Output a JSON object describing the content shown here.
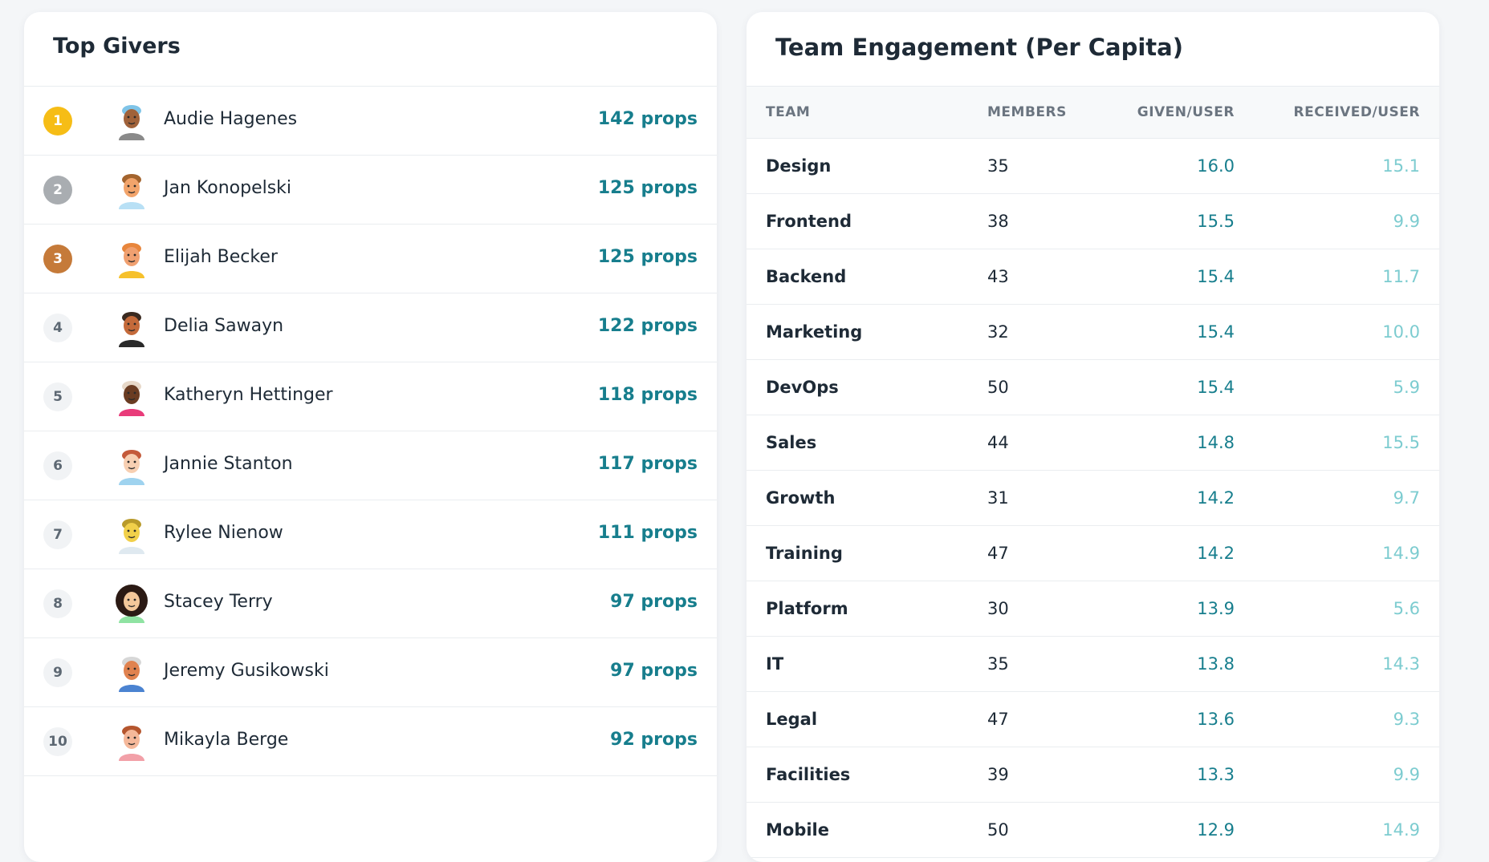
{
  "givers": {
    "title": "Top Givers",
    "items": [
      {
        "rank": "1",
        "name": "Audie Hagenes",
        "props": "142 props"
      },
      {
        "rank": "2",
        "name": "Jan Konopelski",
        "props": "125 props"
      },
      {
        "rank": "3",
        "name": "Elijah Becker",
        "props": "125 props"
      },
      {
        "rank": "4",
        "name": "Delia Sawayn",
        "props": "122 props"
      },
      {
        "rank": "5",
        "name": "Katheryn Hettinger",
        "props": "118 props"
      },
      {
        "rank": "6",
        "name": "Jannie Stanton",
        "props": "117 props"
      },
      {
        "rank": "7",
        "name": "Rylee Nienow",
        "props": "111 props"
      },
      {
        "rank": "8",
        "name": "Stacey Terry",
        "props": "97 props"
      },
      {
        "rank": "9",
        "name": "Jeremy Gusikowski",
        "props": "97 props"
      },
      {
        "rank": "10",
        "name": "Mikayla Berge",
        "props": "92 props"
      }
    ]
  },
  "teams": {
    "title": "Team Engagement (Per Capita)",
    "headers": {
      "team": "TEAM",
      "members": "MEMBERS",
      "given": "GIVEN/USER",
      "received": "RECEIVED/USER"
    },
    "rows": [
      {
        "team": "Design",
        "members": "35",
        "given": "16.0",
        "received": "15.1"
      },
      {
        "team": "Frontend",
        "members": "38",
        "given": "15.5",
        "received": "9.9"
      },
      {
        "team": "Backend",
        "members": "43",
        "given": "15.4",
        "received": "11.7"
      },
      {
        "team": "Marketing",
        "members": "32",
        "given": "15.4",
        "received": "10.0"
      },
      {
        "team": "DevOps",
        "members": "50",
        "given": "15.4",
        "received": "5.9"
      },
      {
        "team": "Sales",
        "members": "44",
        "given": "14.8",
        "received": "15.5"
      },
      {
        "team": "Growth",
        "members": "31",
        "given": "14.2",
        "received": "9.7"
      },
      {
        "team": "Training",
        "members": "47",
        "given": "14.2",
        "received": "14.9"
      },
      {
        "team": "Platform",
        "members": "30",
        "given": "13.9",
        "received": "5.6"
      },
      {
        "team": "IT",
        "members": "35",
        "given": "13.8",
        "received": "14.3"
      },
      {
        "team": "Legal",
        "members": "47",
        "given": "13.6",
        "received": "9.3"
      },
      {
        "team": "Facilities",
        "members": "39",
        "given": "13.3",
        "received": "9.9"
      },
      {
        "team": "Mobile",
        "members": "50",
        "given": "12.9",
        "received": "14.9"
      }
    ]
  },
  "colors": {
    "accent": "#177e8d",
    "received": "#7dccd0",
    "gold": "#f6bd16",
    "silver": "#a9adb1",
    "bronze": "#c57a39"
  }
}
